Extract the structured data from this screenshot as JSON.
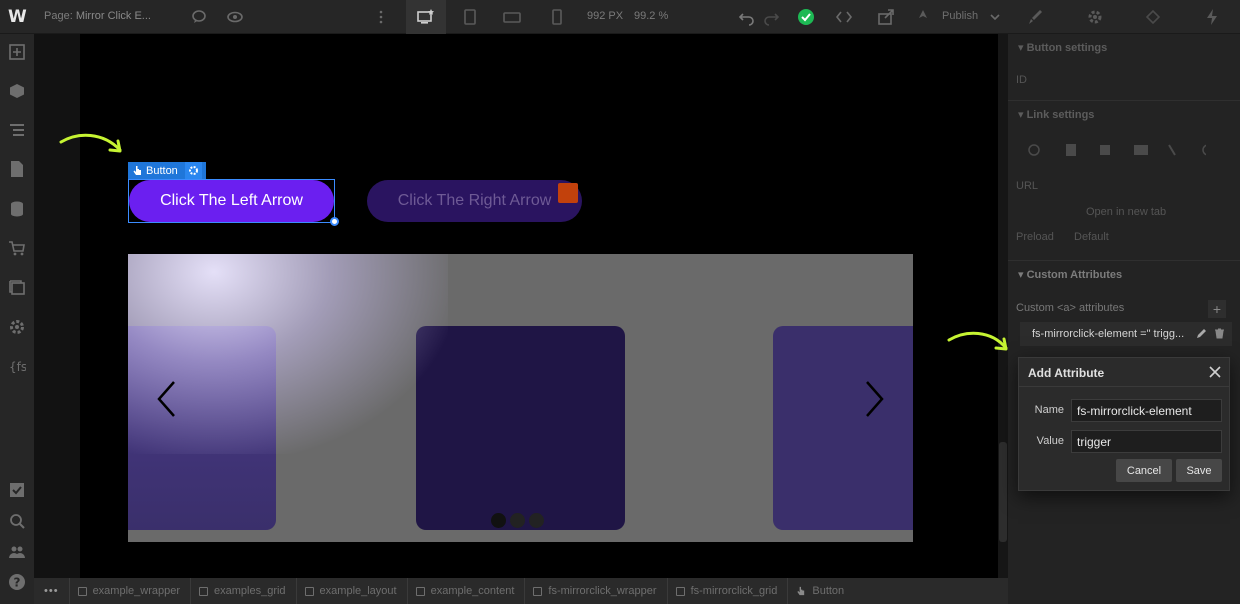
{
  "topbar": {
    "logo": "W",
    "page_prefix": "Page:",
    "page_name": "Mirror Click E...",
    "width_px": "992 PX",
    "zoom": "99.2 %",
    "publish": "Publish"
  },
  "canvas": {
    "selection_tag": "Button",
    "btn_left": "Click The Left Arrow",
    "btn_right": "Click The Right Arrow"
  },
  "breadcrumbs": {
    "more": "•••",
    "items": [
      "example_wrapper",
      "examples_grid",
      "example_layout",
      "example_content",
      "fs-mirrorclick_wrapper",
      "fs-mirrorclick_grid",
      "Button"
    ]
  },
  "panel": {
    "button_settings": "Button settings",
    "id_label": "ID",
    "link_settings": "Link settings",
    "url_label": "URL",
    "new_tab": "Open in new tab",
    "preload_label": "Preload",
    "preload_value": "Default",
    "custom_attrs": "Custom Attributes",
    "custom_attrs_sub": "Custom <a> attributes",
    "attr_row": "fs-mirrorclick-element =\" trigg..."
  },
  "dialog": {
    "title": "Add Attribute",
    "name_label": "Name",
    "name_value": "fs-mirrorclick-element",
    "value_label": "Value",
    "value_value": "trigger",
    "cancel": "Cancel",
    "save": "Save"
  },
  "colors": {
    "accent_green": "#c6f432",
    "selection_blue": "#1f76d9",
    "button_purple": "#6b1ff0"
  }
}
